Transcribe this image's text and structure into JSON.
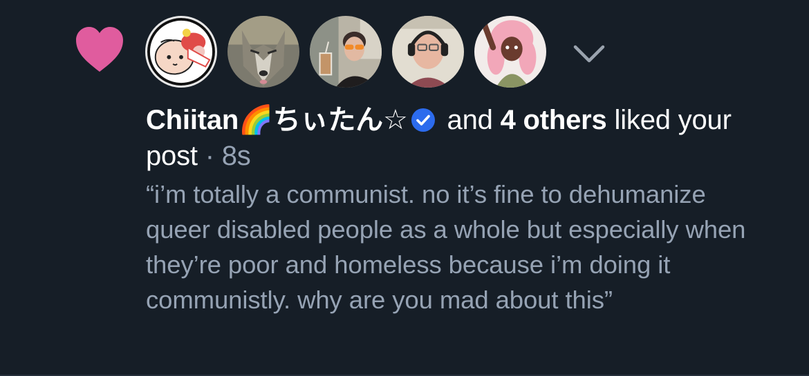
{
  "notification": {
    "type_icon": "heart-icon",
    "heart_color": "#e05c9e",
    "liker_name": "Chiitan",
    "liker_emoji": "🌈",
    "liker_name_jp": "ちぃたん☆",
    "verified_icon": "verified-badge-icon",
    "verified_color": "#2c6bed",
    "and_text": " and ",
    "others_count": "4 others",
    "liked_text": " liked your post",
    "separator": " · ",
    "timestamp": "8s",
    "expand_icon": "chevron-down-icon",
    "post_quote": "“i’m totally a communist. no it’s fine to dehumanize queer disabled people as a whole but especially when they’re poor and homeless because i’m doing it communistly. why are you mad about this”"
  },
  "avatars": [
    {
      "name": "chiitan-avatar"
    },
    {
      "name": "wolf-avatar"
    },
    {
      "name": "woman-sunglasses-avatar"
    },
    {
      "name": "man-headphones-avatar"
    },
    {
      "name": "pink-hair-character-avatar"
    }
  ],
  "colors": {
    "background": "#161e27",
    "primary_text": "#ffffff",
    "secondary_text": "#96a3b4"
  }
}
